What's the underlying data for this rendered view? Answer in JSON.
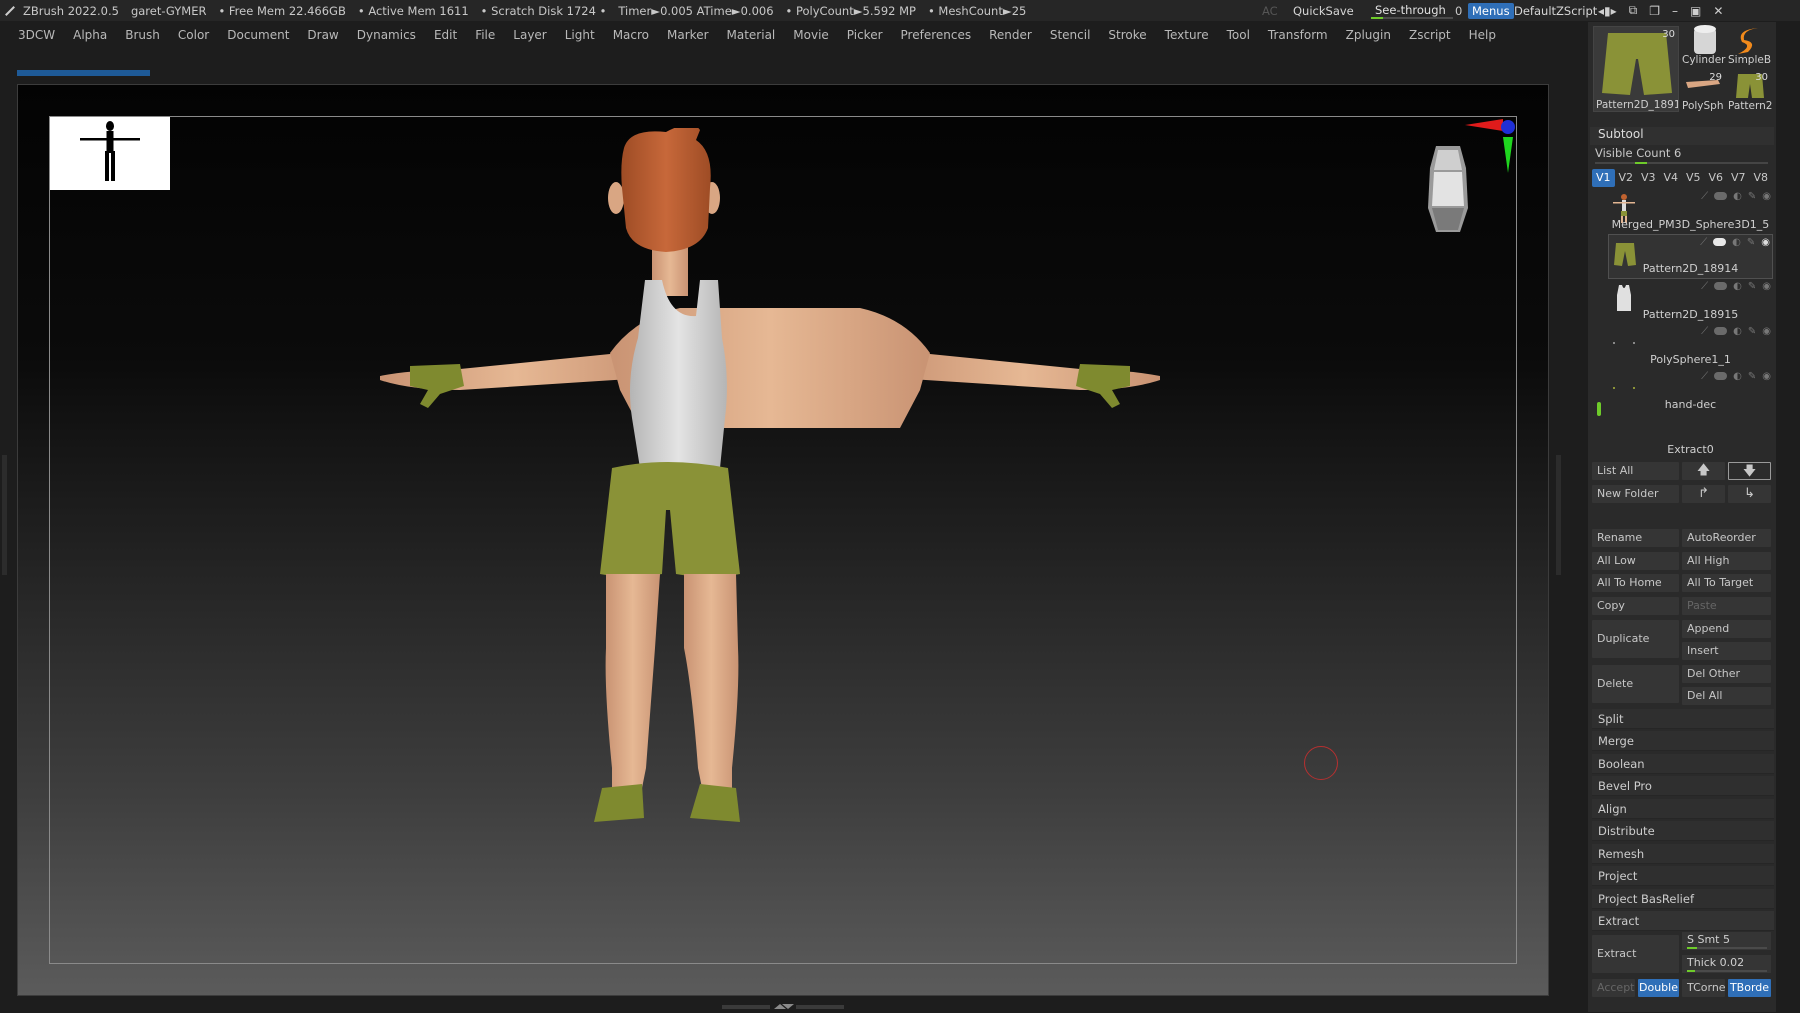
{
  "titlebar": {
    "app": "ZBrush 2022.0.5",
    "user": "garet-GYMER",
    "free_mem": "• Free Mem 22.466GB",
    "active_mem": "• Active Mem 1611",
    "scratch": "• Scratch Disk 1724 •",
    "timer": "Timer►0.005 ATime►0.006",
    "polycount": "• PolyCount►5.592 MP",
    "meshcount": "• MeshCount►25",
    "ac": "AC",
    "quicksave": "QuickSave",
    "see_through_label": "See-through",
    "see_through_value": "0",
    "menus": "Menus",
    "default_zscript": "DefaultZScript"
  },
  "menubar": [
    "3DCW",
    "Alpha",
    "Brush",
    "Color",
    "Document",
    "Draw",
    "Dynamics",
    "Edit",
    "File",
    "Layer",
    "Light",
    "Macro",
    "Marker",
    "Material",
    "Movie",
    "Picker",
    "Preferences",
    "Render",
    "Stencil",
    "Stroke",
    "Texture",
    "Tool",
    "Transform",
    "Zplugin",
    "Zscript",
    "Help"
  ],
  "colors": {
    "accent_blue": "#2f6fb8",
    "slider_green": "#6ecb2a",
    "skin": "#e2b592",
    "hair": "#c0622f",
    "shorts": "#8a9237",
    "tank": "#d6d6d6"
  },
  "tool_thumbs": {
    "main_label": "Pattern2D_1891",
    "main_count": "30",
    "cylinder": "Cylinder",
    "simpleb": "SimpleB",
    "polysph": "PolySph",
    "pattern": "Pattern2",
    "polysph_count": "29",
    "pattern_count": "30"
  },
  "subtool": {
    "header": "Subtool",
    "visible_count": "Visible Count 6",
    "visible_count_value": 6,
    "tabs": [
      "V1",
      "V2",
      "V3",
      "V4",
      "V5",
      "V6",
      "V7",
      "V8"
    ],
    "items": [
      {
        "name": "Merged_PM3D_Sphere3D1_5"
      },
      {
        "name": "Pattern2D_18914"
      },
      {
        "name": "Pattern2D_18915"
      },
      {
        "name": "PolySphere1_1"
      },
      {
        "name": "hand-dec"
      },
      {
        "name": "Extract0"
      }
    ],
    "list_all": "List All",
    "new_folder": "New Folder",
    "rename": "Rename",
    "autoreorder": "AutoReorder",
    "all_low": "All Low",
    "all_high": "All High",
    "all_to_home": "All To Home",
    "all_to_target": "All To Target",
    "copy": "Copy",
    "paste": "Paste",
    "duplicate": "Duplicate",
    "append": "Append",
    "insert": "Insert",
    "delete": "Delete",
    "del_other": "Del Other",
    "del_all": "Del All",
    "sections": [
      "Split",
      "Merge",
      "Boolean",
      "Bevel Pro",
      "Align",
      "Distribute",
      "Remesh",
      "Project",
      "Project BasRelief",
      "Extract"
    ],
    "extract_btn": "Extract",
    "s_smt": "S Smt 5",
    "s_smt_value": 5,
    "thick": "Thick 0.02",
    "thick_value": 0.02,
    "accept": "Accept",
    "double": "Double",
    "tcorne": "TCorne",
    "tborde": "TBorde"
  }
}
